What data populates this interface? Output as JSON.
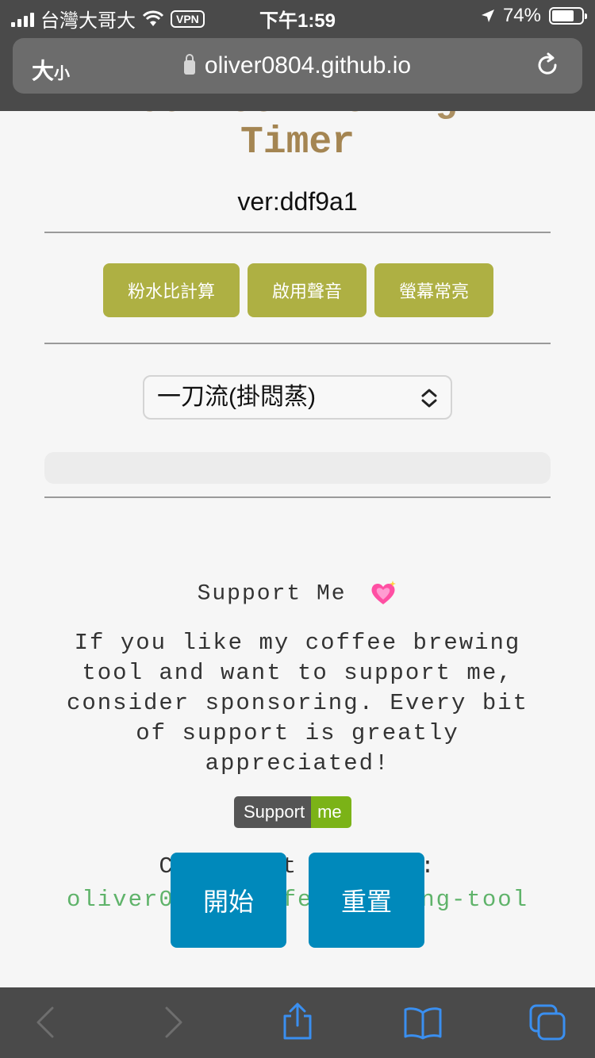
{
  "status_bar": {
    "carrier": "台灣大哥大",
    "vpn": "VPN",
    "time": "下午1:59",
    "battery": "74%",
    "battery_level": 0.74
  },
  "browser": {
    "text_size_label_big": "大",
    "text_size_label_small": "小",
    "url": "oliver0804.github.io"
  },
  "page": {
    "title_line1": "Coffee Brewing",
    "title_line2": "Timer",
    "version": "ver:ddf9a1",
    "buttons": {
      "ratio": "粉水比計算",
      "sound": "啟用聲音",
      "screen": "螢幕常亮"
    },
    "method_select": "一刀流(掛悶蒸)",
    "support_title": "Support Me",
    "support_body": "If you like my coffee brewing tool and want to support me, consider sponsoring. Every bit of support is greatly appreciated!",
    "badge_left": "Support",
    "badge_right": "me",
    "check_repo": "Check out my repo:",
    "repo_name": "oliver0804/Coffee-brewing-tool",
    "start": "開始",
    "reset": "重置"
  },
  "colors": {
    "title": "#a48552",
    "olive_button": "#aeb043",
    "blue_button": "#0089bb",
    "link": "#5fb36a",
    "chrome": "#4a4a4a"
  }
}
